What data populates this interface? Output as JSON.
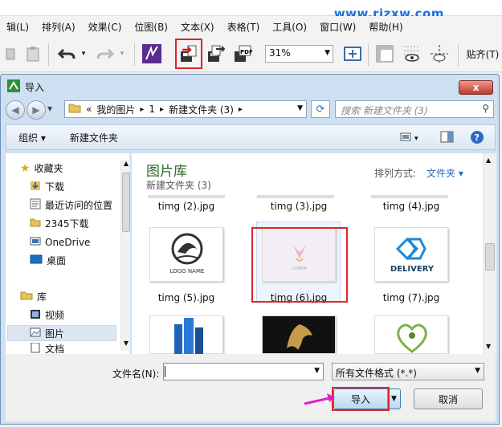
{
  "watermark": "www.rjzxw.com",
  "menubar": [
    "辑(L)",
    "排列(A)",
    "效果(C)",
    "位图(B)",
    "文本(X)",
    "表格(T)",
    "工具(O)",
    "窗口(W)",
    "帮助(H)"
  ],
  "toolbar": {
    "zoom_value": "31%",
    "snap_label": "贴齐(T)"
  },
  "dialog": {
    "title": "导入",
    "close_label": "x",
    "address": {
      "chevron": "«",
      "segments": [
        "我的图片",
        "1",
        "新建文件夹 (3)"
      ]
    },
    "search_placeholder": "搜索 新建文件夹 (3)",
    "commands": {
      "organize": "组织 ▾",
      "new_folder": "新建文件夹"
    },
    "nav": {
      "favorites": "收藏夹",
      "items": [
        "下载",
        "最近访问的位置",
        "2345下载",
        "OneDrive",
        "桌面"
      ],
      "library": "库",
      "lib_items": [
        "视频",
        "图片",
        "文档"
      ]
    },
    "content": {
      "title": "图片库",
      "subtitle": "新建文件夹 (3)",
      "sort_label": "排列方式:",
      "sort_value": "文件夹 ▾",
      "files": [
        {
          "name": "timg (2).jpg"
        },
        {
          "name": "timg (3).jpg"
        },
        {
          "name": "timg (4).jpg"
        },
        {
          "name": "timg (5).jpg",
          "logo": "LOGO NAME"
        },
        {
          "name": "timg (6).jpg",
          "logo": "LOREM"
        },
        {
          "name": "timg (7).jpg",
          "logo": "DELIVERY"
        }
      ]
    },
    "footer": {
      "filename_label": "文件名(N):",
      "filename_value": "",
      "filetype": "所有文件格式 (*.*)",
      "import_label": "导入",
      "cancel_label": "取消"
    }
  },
  "colors": {
    "highlight": "#d9262c",
    "accent": "#2a6ab8",
    "arrow": "#e020c8"
  }
}
